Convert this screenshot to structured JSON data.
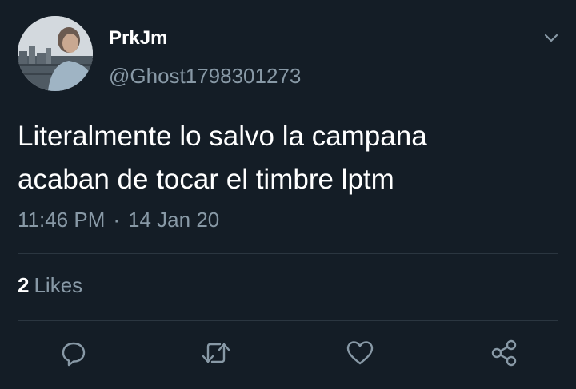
{
  "tweet": {
    "display_name": "PrkJm",
    "handle": "@Ghost1798301273",
    "text": "Literalmente lo salvo la campana\nacaban de tocar el timbre lptm",
    "time": "11:46 PM",
    "separator": "·",
    "date": "14 Jan 20",
    "likes_count": "2",
    "likes_label": "Likes"
  },
  "icons": {
    "menu": "chevron-down-icon",
    "reply": "reply-icon",
    "retweet": "retweet-icon",
    "like": "heart-icon",
    "share": "share-icon"
  },
  "colors": {
    "background": "#141d26",
    "primary_text": "#ffffff",
    "secondary_text": "#8899a6",
    "divider": "#2b3640"
  }
}
